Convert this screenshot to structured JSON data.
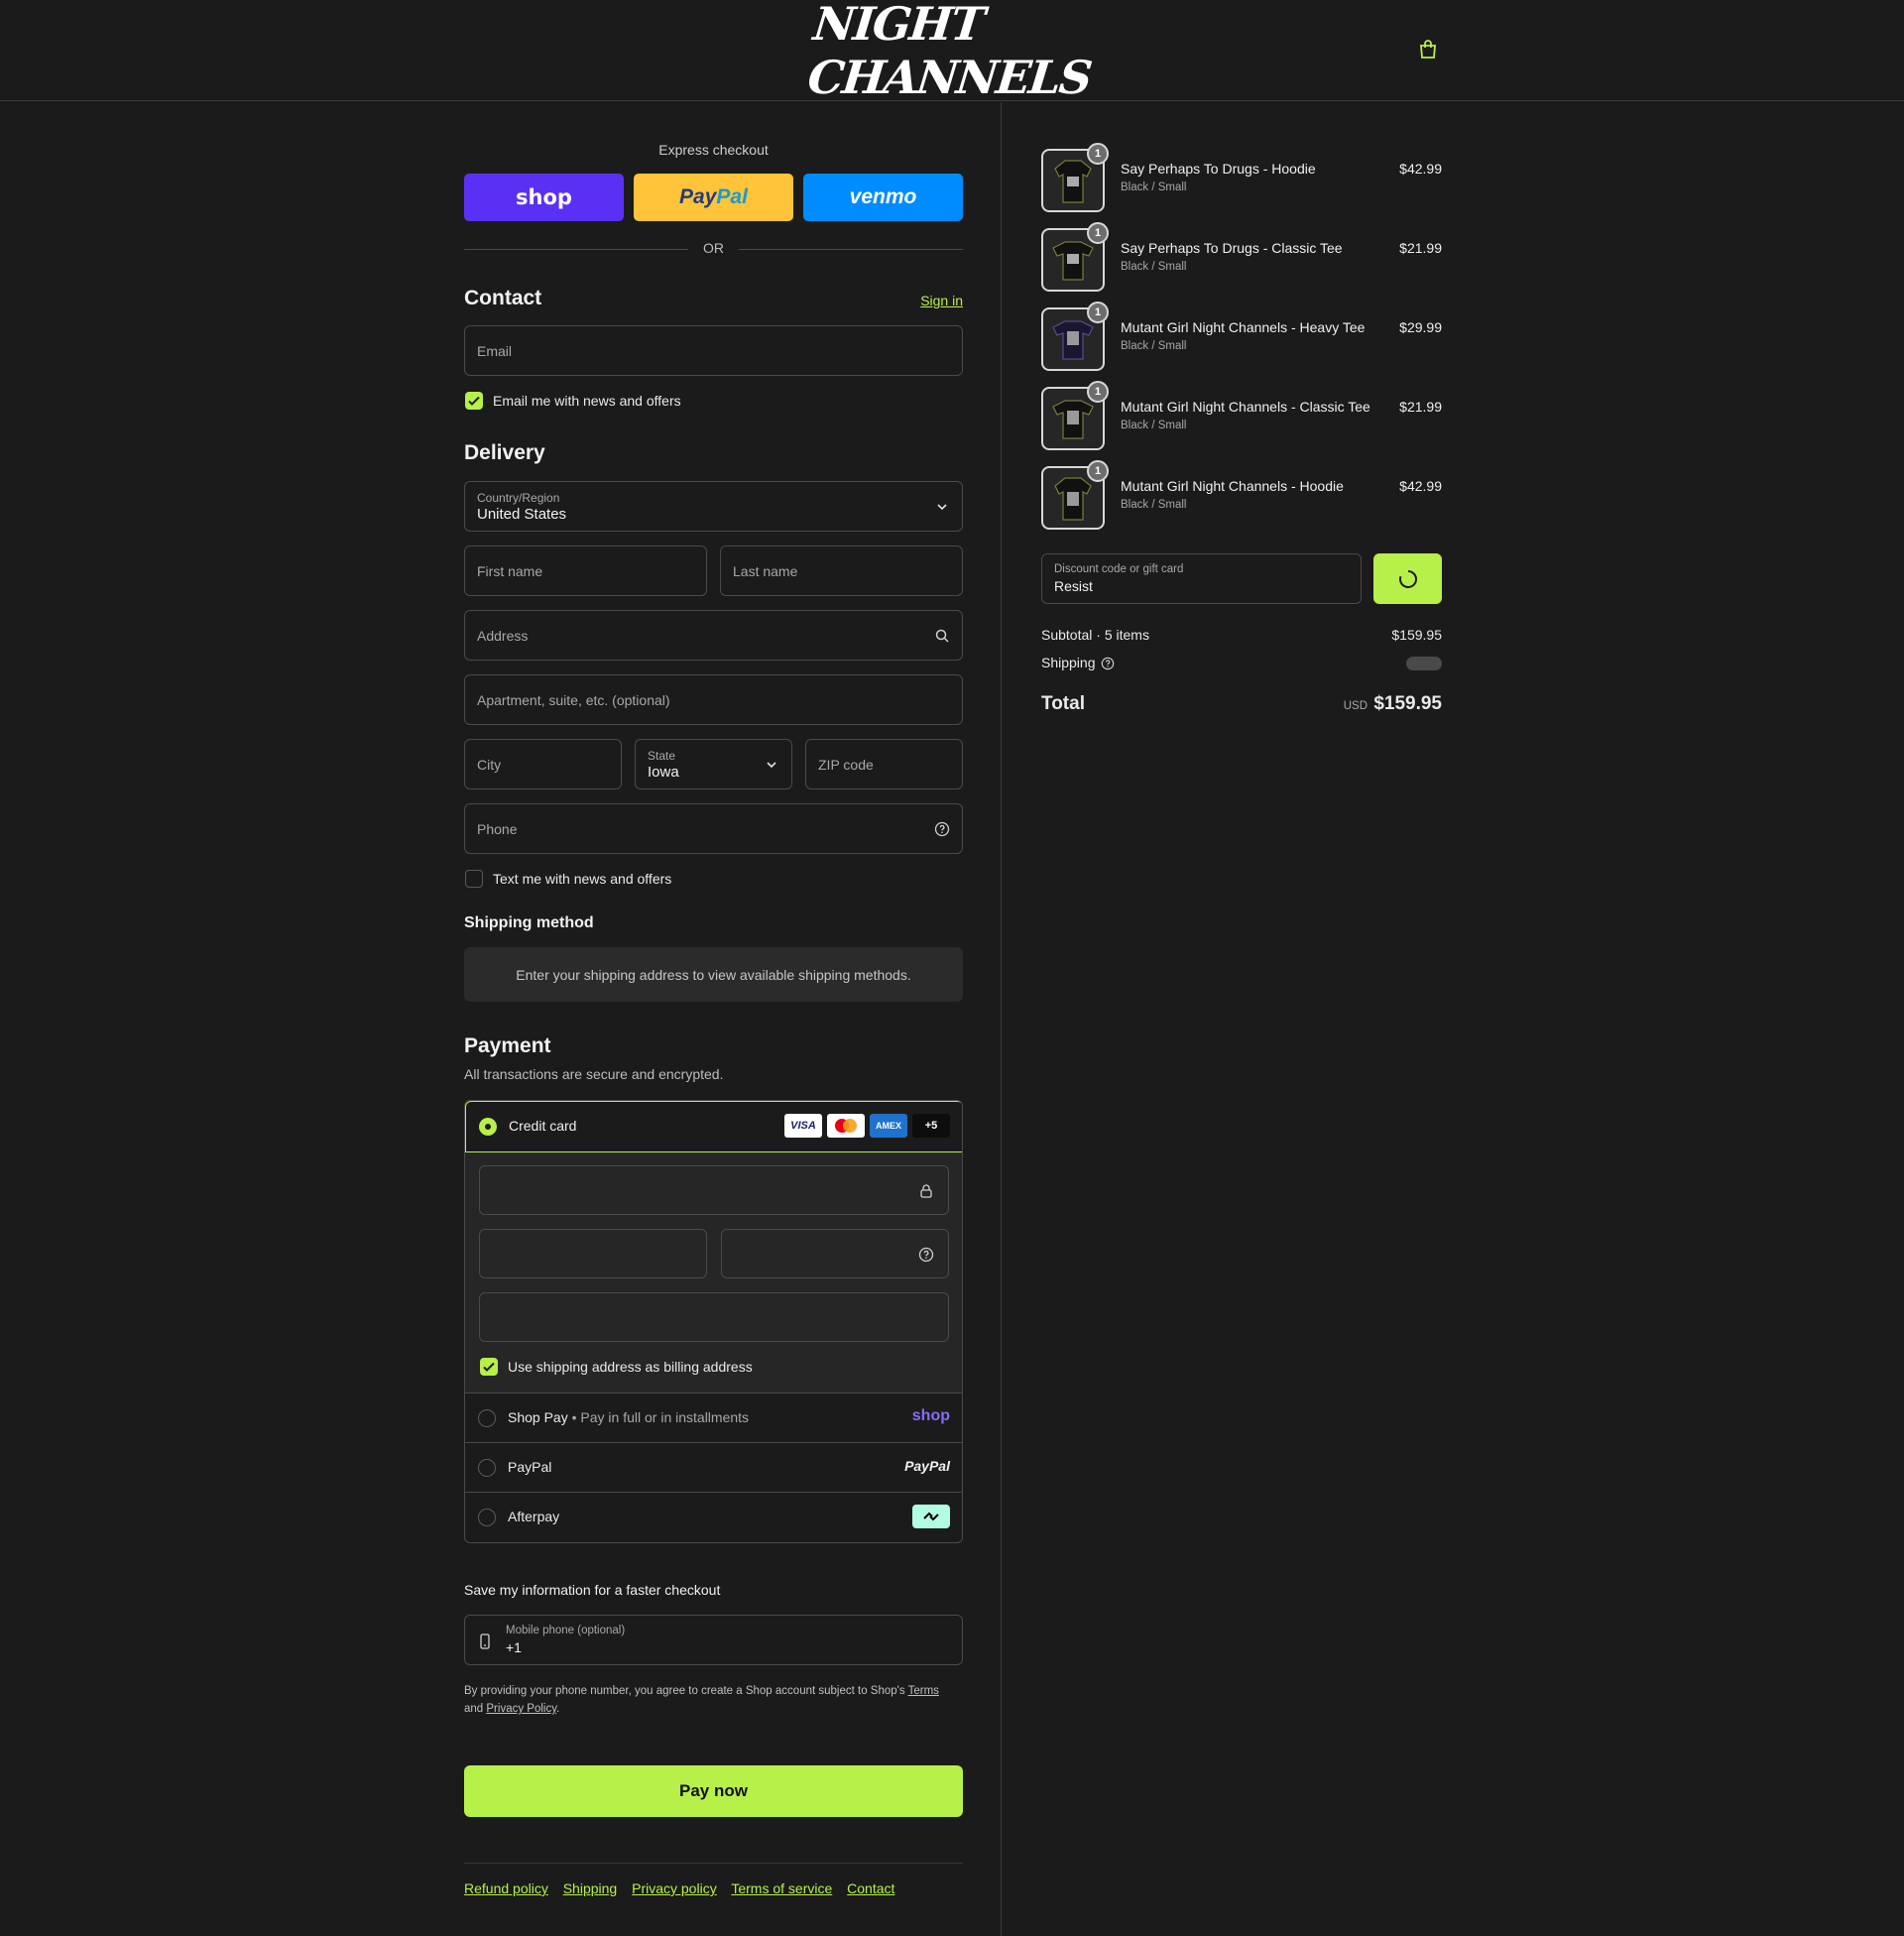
{
  "header": {
    "logo_text": "NIGHT CHANNELS",
    "cart_icon": "shopping-bag-icon"
  },
  "express": {
    "label": "Express checkout",
    "shop_label": "shop",
    "paypal_label": "PayPal",
    "venmo_label": "venmo",
    "or_label": "OR"
  },
  "contact": {
    "title": "Contact",
    "sign_in": "Sign in",
    "email_placeholder": "Email",
    "email_news_label": "Email me with news and offers",
    "email_news_checked": true
  },
  "delivery": {
    "title": "Delivery",
    "country_label": "Country/Region",
    "country_value": "United States",
    "first_name_placeholder": "First name",
    "last_name_placeholder": "Last name",
    "address_placeholder": "Address",
    "apartment_placeholder": "Apartment, suite, etc. (optional)",
    "city_placeholder": "City",
    "state_label": "State",
    "state_value": "Iowa",
    "zip_placeholder": "ZIP code",
    "phone_placeholder": "Phone",
    "text_news_label": "Text me with news and offers",
    "text_news_checked": false
  },
  "shipping_method": {
    "title": "Shipping method",
    "notice": "Enter your shipping address to view available shipping methods."
  },
  "payment": {
    "title": "Payment",
    "subtitle": "All transactions are secure and encrypted.",
    "credit_card_label": "Credit card",
    "card_brands": [
      "VISA",
      "Mastercard",
      "AMEX",
      "+5"
    ],
    "billing_same_label": "Use shipping address as billing address",
    "billing_same_checked": true,
    "shop_pay_label": "Shop Pay",
    "shop_pay_sub": "Pay in full or in installments",
    "shop_pay_logo": "shop",
    "paypal_label": "PayPal",
    "paypal_logo": "PayPal",
    "afterpay_label": "Afterpay"
  },
  "save_info": {
    "title": "Save my information for a faster checkout",
    "mobile_label": "Mobile phone (optional)",
    "mobile_value": "+1",
    "legal_prefix": "By providing your phone number, you agree to create a Shop account subject to Shop's",
    "terms_link": "Terms",
    "legal_and": "and",
    "privacy_link": "Privacy Policy",
    "legal_end": "."
  },
  "pay_now": "Pay now",
  "footer_links": [
    "Refund policy",
    "Shipping",
    "Privacy policy",
    "Terms of service",
    "Contact"
  ],
  "order": {
    "items": [
      {
        "name": "Say Perhaps To Drugs - Hoodie",
        "variant": "Black / Small",
        "price": "$42.99",
        "qty": "1"
      },
      {
        "name": "Say Perhaps To Drugs - Classic Tee",
        "variant": "Black / Small",
        "price": "$21.99",
        "qty": "1"
      },
      {
        "name": "Mutant Girl Night Channels - Heavy Tee",
        "variant": "Black / Small",
        "price": "$29.99",
        "qty": "1"
      },
      {
        "name": "Mutant Girl Night Channels - Classic Tee",
        "variant": "Black / Small",
        "price": "$21.99",
        "qty": "1"
      },
      {
        "name": "Mutant Girl Night Channels - Hoodie",
        "variant": "Black / Small",
        "price": "$42.99",
        "qty": "1"
      }
    ],
    "discount_label": "Discount code or gift card",
    "discount_value": "Resist",
    "subtotal_label": "Subtotal · 5 items",
    "subtotal_value": "$159.95",
    "shipping_label": "Shipping",
    "total_label": "Total",
    "total_currency": "USD",
    "total_value": "$159.95"
  },
  "colors": {
    "accent": "#b8f04a",
    "background": "#1b1b1b",
    "shop_purple": "#5a31f4",
    "paypal_yellow": "#ffc439",
    "venmo_blue": "#008cff"
  }
}
